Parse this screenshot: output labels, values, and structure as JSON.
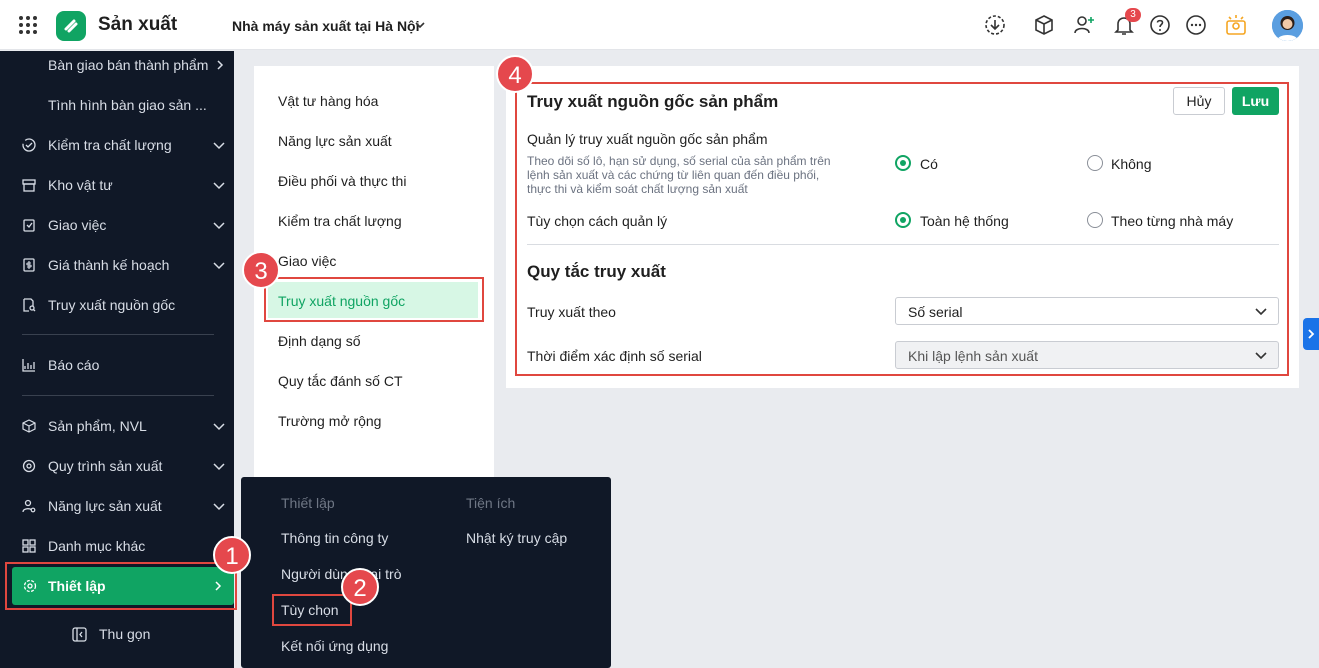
{
  "header": {
    "app_title": "Sản xuất",
    "factory": "Nhà máy sản xuất tại Hà Nội",
    "notification_count": "3"
  },
  "sidebar": {
    "items": [
      {
        "label": "Bàn giao bán thành phẩm",
        "icon": "none"
      },
      {
        "label": "Tình hình bàn giao sản ...",
        "icon": "none"
      },
      {
        "label": "Kiểm tra chất lượng",
        "icon": "check-circle-icon"
      },
      {
        "label": "Kho vật tư",
        "icon": "box-icon"
      },
      {
        "label": "Giao việc",
        "icon": "clipboard-icon"
      },
      {
        "label": "Giá thành kế hoạch",
        "icon": "dollar-icon"
      },
      {
        "label": "Truy xuất nguồn gốc",
        "icon": "search-doc-icon"
      },
      {
        "label": "Báo cáo",
        "icon": "chart-icon"
      },
      {
        "label": "Sản phẩm, NVL",
        "icon": "cube-icon"
      },
      {
        "label": "Quy trình sản xuất",
        "icon": "process-icon"
      },
      {
        "label": "Năng lực sản xuất",
        "icon": "user-gear-icon"
      },
      {
        "label": "Danh mục khác",
        "icon": "grid-icon"
      }
    ],
    "settings_label": "Thiết lập",
    "collapse_label": "Thu gọn"
  },
  "settings_menu": {
    "items": [
      "Vật tư hàng hóa",
      "Năng lực sản xuất",
      "Điều phối và thực thi",
      "Kiểm tra chất lượng",
      "Giao việc",
      "Truy xuất nguồn gốc",
      "Định dạng số",
      "Quy tắc đánh số CT",
      "Trường mở rộng"
    ],
    "active_index": 5
  },
  "content": {
    "title": "Truy xuất nguồn gốc sản phẩm",
    "cancel_label": "Hủy",
    "save_label": "Lưu",
    "manage_label": "Quản lý truy xuất nguồn gốc sản phẩm",
    "manage_desc": "Theo dõi số lô, hạn sử dụng, số serial của sản phẩm trên lệnh sản xuất và các chứng từ liên quan đến điều phối, thực thi và kiểm soát chất lượng sản xuất",
    "opt_yes": "Có",
    "opt_no": "Không",
    "mode_label": "Tùy chọn cách quản lý",
    "opt_system": "Toàn hệ thống",
    "opt_factory": "Theo từng nhà máy",
    "rules_title": "Quy tắc truy xuất",
    "trace_by_label": "Truy xuất theo",
    "trace_by_value": "Số serial",
    "serial_time_label": "Thời điểm xác định số serial",
    "serial_time_value": "Khi lập lệnh sản xuất"
  },
  "popup": {
    "col1_header": "Thiết lập",
    "col2_header": "Tiện ích",
    "col1_items": [
      "Thông tin công ty",
      "Người dùng, vai trò",
      "Tùy chọn",
      "Kết nối ứng dụng"
    ],
    "col2_items": [
      "Nhật ký truy cập"
    ]
  },
  "callouts": [
    "1",
    "2",
    "3",
    "4"
  ],
  "colors": {
    "accent": "#10a463",
    "sidebar": "#101827",
    "highlight": "#e0473f"
  }
}
